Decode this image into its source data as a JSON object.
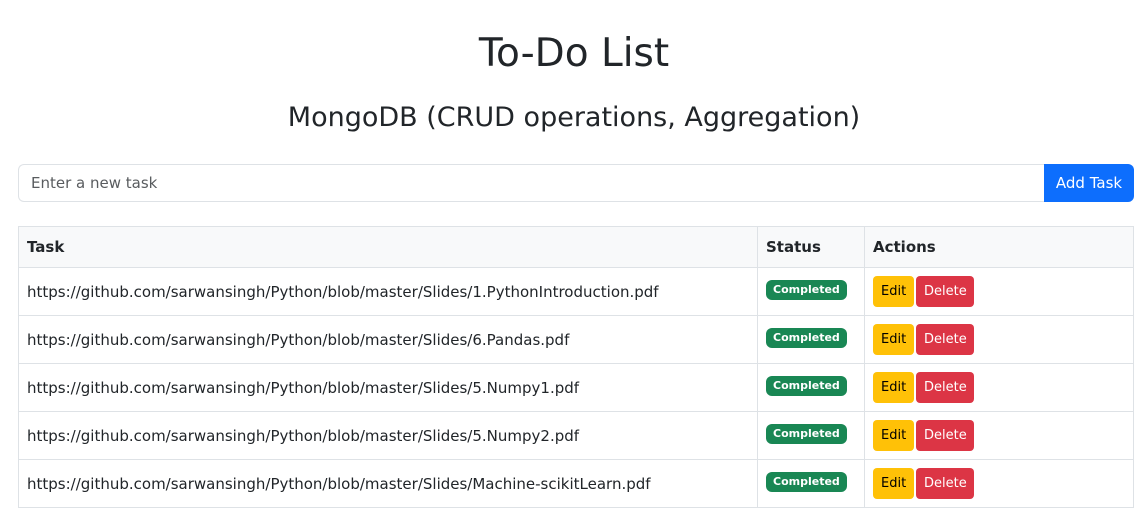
{
  "header": {
    "title": "To-Do List",
    "subtitle": "MongoDB (CRUD operations, Aggregation)"
  },
  "new_task": {
    "placeholder": "Enter a new task",
    "value": "",
    "add_label": "Add Task"
  },
  "table": {
    "columns": [
      "Task",
      "Status",
      "Actions"
    ],
    "rows": [
      {
        "task": "https://github.com/sarwansingh/Python/blob/master/Slides/1.PythonIntroduction.pdf",
        "status": "Completed",
        "edit_label": "Edit",
        "delete_label": "Delete"
      },
      {
        "task": "https://github.com/sarwansingh/Python/blob/master/Slides/6.Pandas.pdf",
        "status": "Completed",
        "edit_label": "Edit",
        "delete_label": "Delete"
      },
      {
        "task": "https://github.com/sarwansingh/Python/blob/master/Slides/5.Numpy1.pdf",
        "status": "Completed",
        "edit_label": "Edit",
        "delete_label": "Delete"
      },
      {
        "task": "https://github.com/sarwansingh/Python/blob/master/Slides/5.Numpy2.pdf",
        "status": "Completed",
        "edit_label": "Edit",
        "delete_label": "Delete"
      },
      {
        "task": "https://github.com/sarwansingh/Python/blob/master/Slides/Machine-scikitLearn.pdf",
        "status": "Completed",
        "edit_label": "Edit",
        "delete_label": "Delete"
      }
    ]
  },
  "colors": {
    "primary": "#0d6efd",
    "success": "#198754",
    "warning": "#ffc107",
    "danger": "#dc3545"
  }
}
